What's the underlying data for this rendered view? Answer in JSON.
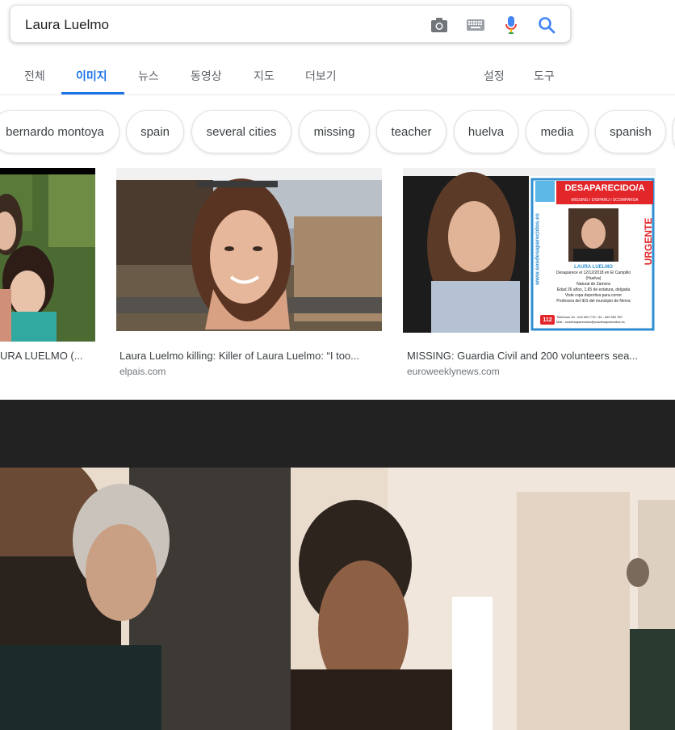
{
  "search": {
    "query": "Laura Luelmo"
  },
  "tabs": [
    {
      "label": "전체"
    },
    {
      "label": "이미지"
    },
    {
      "label": "뉴스"
    },
    {
      "label": "동영상"
    },
    {
      "label": "지도"
    },
    {
      "label": "더보기"
    },
    {
      "label": "설정"
    },
    {
      "label": "도구"
    }
  ],
  "chips": [
    {
      "label": "bernardo montoya"
    },
    {
      "label": "spain"
    },
    {
      "label": "several cities"
    },
    {
      "label": "missing"
    },
    {
      "label": "teacher"
    },
    {
      "label": "huelva"
    },
    {
      "label": "media"
    },
    {
      "label": "spanish"
    }
  ],
  "results": [
    {
      "title": "URA LUELMO (..."
    },
    {
      "title": "Laura Luelmo killing: Killer of Laura Luelmo: “I too...",
      "source": "elpais.com"
    },
    {
      "title": "MISSING: Guardia Civil and 200 volunteers sea...",
      "source": "euroweeklynews.com"
    }
  ],
  "poster": {
    "header": "DESAPARECIDO/A",
    "subheader": "MISSING / DISPARU / SCOMPARSA",
    "side_label": "www.sosdesaparecidos.es",
    "urgent": "URGENTE",
    "name": "LAURA LUELMO",
    "line1": "Desaparece el 12/12/2018 en El Campillo (Huelva)",
    "line2": "Natural de Zamora",
    "line3": "Edad 26 años, 1,65 de estatura, delgada",
    "line4": "Viste ropa deportiva para correr",
    "line5": "Profesora del IES del municipio de Nerva",
    "emergency": "112",
    "phone": "Teléfonos 34 - 642 650 775 / 34 - 649 952 957",
    "mail": "Mail - sosdesaparecidos@sosdesaparecidos.es"
  },
  "colors": {
    "accent": "#1a73e8",
    "poster_red": "#e3262a",
    "poster_blue": "#2f8fd1"
  }
}
